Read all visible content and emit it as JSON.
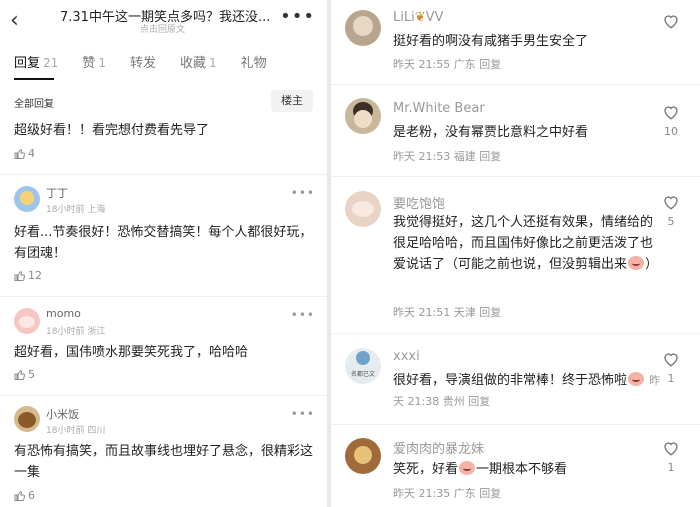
{
  "left": {
    "header": {
      "back_icon": "‹",
      "title": "7.31中午这一期笑点多吗？我还没...",
      "subtitle": "点击回原文",
      "more_icon": "•••"
    },
    "tabs": [
      {
        "label": "回复",
        "count": "21"
      },
      {
        "label": "赞",
        "count": "1"
      },
      {
        "label": "转发",
        "count": ""
      },
      {
        "label": "收藏",
        "count": "1"
      },
      {
        "label": "礼物",
        "count": ""
      }
    ],
    "all_replies_label": "全部回复",
    "sort_button": "楼主",
    "top_comment": {
      "text": "超级好看！！看完想付费看先导了",
      "likes": "4"
    },
    "comments": [
      {
        "name": "丁丁",
        "time": "18小时前",
        "location": "上海",
        "text": "好看...节奏很好！恐怖交替搞笑！每个人都很好玩，有团魂！",
        "likes": "12",
        "avatar_color": "#9fc5e8"
      },
      {
        "name": "momo",
        "time": "18小时前",
        "location": "浙江",
        "text": "超好看，国伟喷水那要笑死我了，哈哈哈",
        "likes": "5",
        "avatar_color": "#f4c7c3"
      },
      {
        "name": "小米饭",
        "time": "18小时前",
        "location": "四川",
        "text": "有恐怖有搞笑，而且故事线也埋好了悬念，很精彩这一集",
        "likes": "6",
        "avatar_color": "#d7b98e"
      }
    ]
  },
  "right": {
    "comments": [
      {
        "name": "LiLi",
        "name_suffix": "VV",
        "text": "挺好看的啊没有咸猪手男生安全了",
        "date": "昨天",
        "time": "21:55",
        "location": "广东",
        "reply": "回复",
        "likes": "",
        "avatar_color": "#b9a48f"
      },
      {
        "name": "Mr.White Bear",
        "text": "是老粉，没有幂贾比意料之中好看",
        "date": "昨天",
        "time": "21:53",
        "location": "福建",
        "reply": "回复",
        "likes": "10",
        "avatar_color": "#c9b79c"
      },
      {
        "name": "要吃饱饱",
        "text_before": "我觉得挺好，这几个人还挺有效果，情绪给的很足哈哈哈，而且国伟好像比之前更活泼了也爱说话了（可能之前也说，但没剪辑出来",
        "text_after": "）",
        "date": "昨天",
        "time": "21:51",
        "location": "天津",
        "reply": "回复",
        "likes": "5",
        "avatar_color": "#e8d3c4"
      },
      {
        "name": "xxxi",
        "text": "很好看，导演组做的非常棒！终于恐怖啦",
        "date": "昨天",
        "time": "21:38",
        "location": "贵州",
        "reply": "回复",
        "likes": "1",
        "avatar_color": "#e4ecf0",
        "avatar_caption": "名都已文"
      },
      {
        "name": "爱肉肉的暴龙妹",
        "text_before": "笑死，好看",
        "text_after": "一期根本不够看",
        "date": "昨天",
        "time": "21:35",
        "location": "广东",
        "reply": "回复",
        "likes": "1",
        "avatar_color": "#a06a3a"
      }
    ]
  }
}
